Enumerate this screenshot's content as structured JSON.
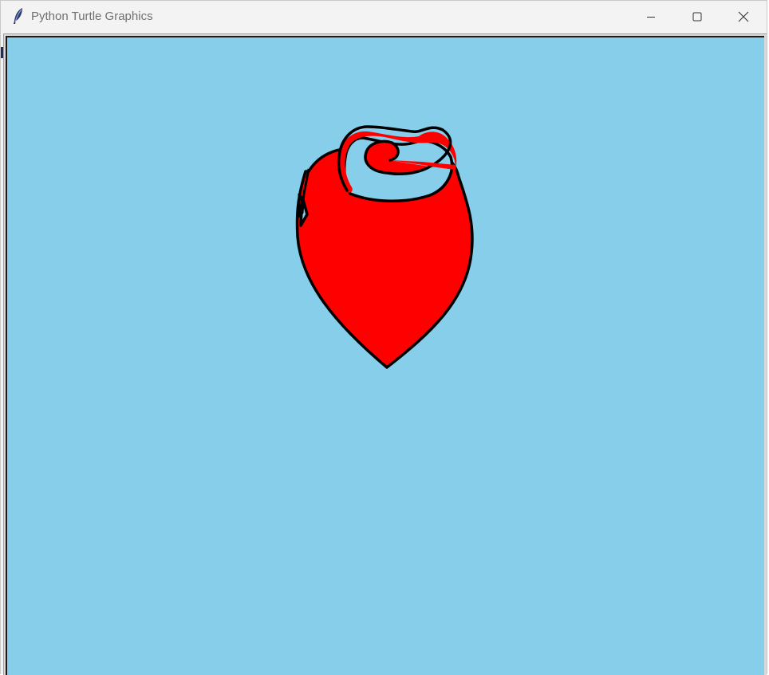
{
  "window": {
    "title": "Python Turtle Graphics",
    "app_icon": "feather-icon",
    "controls": {
      "minimize_icon": "minimize-icon",
      "maximize_icon": "maximize-icon",
      "close_icon": "close-icon"
    }
  },
  "canvas": {
    "background_color": "#87CEEB",
    "drawing": {
      "shape": "rose",
      "fill_color": "#FF0000",
      "outline_color": "#000000",
      "spiral_inner_color": "#87CEEB"
    }
  }
}
